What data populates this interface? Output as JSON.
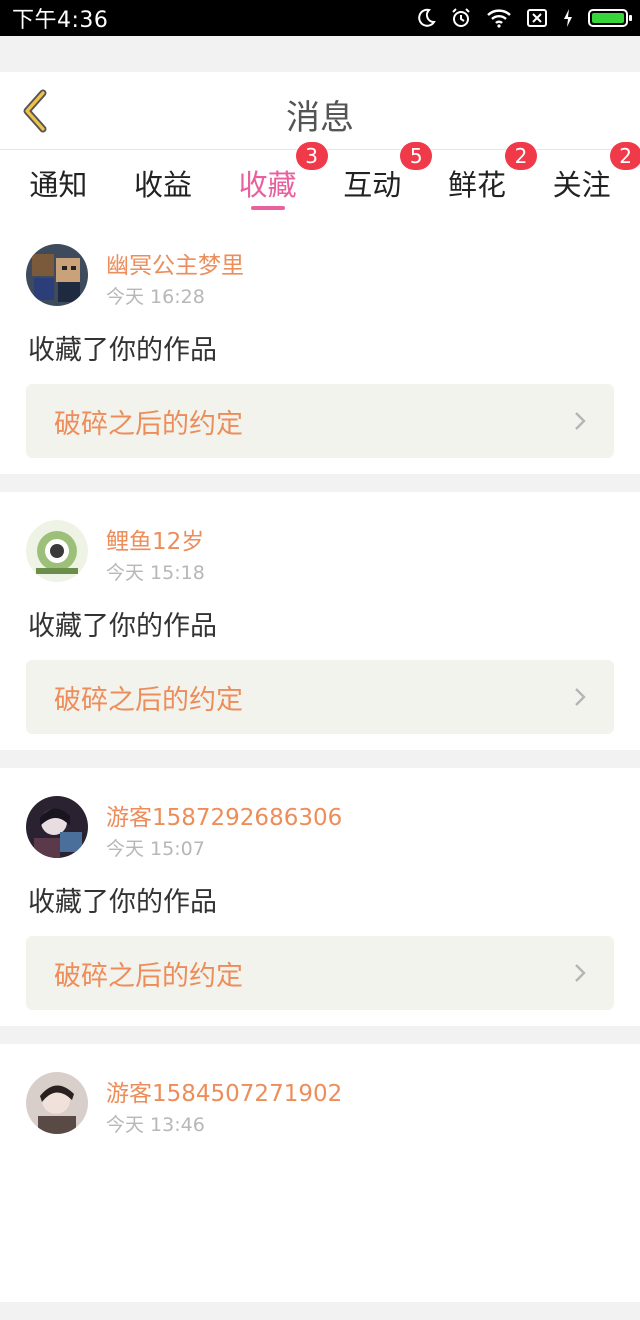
{
  "status_bar": {
    "time": "下午4:36"
  },
  "header": {
    "title": "消息"
  },
  "tabs": [
    {
      "label": "通知",
      "badge": ""
    },
    {
      "label": "收益",
      "badge": ""
    },
    {
      "label": "收藏",
      "badge": "3",
      "active": true
    },
    {
      "label": "互动",
      "badge": "5"
    },
    {
      "label": "鲜花",
      "badge": "2"
    },
    {
      "label": "关注",
      "badge": "2"
    }
  ],
  "feed": [
    {
      "username": "幽冥公主梦里",
      "time": "今天 16:28",
      "action": "收藏了你的作品",
      "work_title": "破碎之后的约定"
    },
    {
      "username": "鲤鱼12岁",
      "time": "今天 15:18",
      "action": "收藏了你的作品",
      "work_title": "破碎之后的约定"
    },
    {
      "username": "游客1587292686306",
      "time": "今天 15:07",
      "action": "收藏了你的作品",
      "work_title": "破碎之后的约定"
    },
    {
      "username": "游客1584507271902",
      "time": "今天 13:46",
      "action": "",
      "work_title": ""
    }
  ],
  "colors": {
    "accent_pink": "#e9609e",
    "name_orange": "#ec8d5a",
    "badge_red": "#f03a4a",
    "back_arrow": "#f0c24a"
  },
  "icons": [
    "back-arrow-icon",
    "moon-icon",
    "alarm-icon",
    "wifi-icon",
    "no-sim-icon",
    "charging-icon",
    "battery-icon",
    "chevron-right-icon"
  ]
}
